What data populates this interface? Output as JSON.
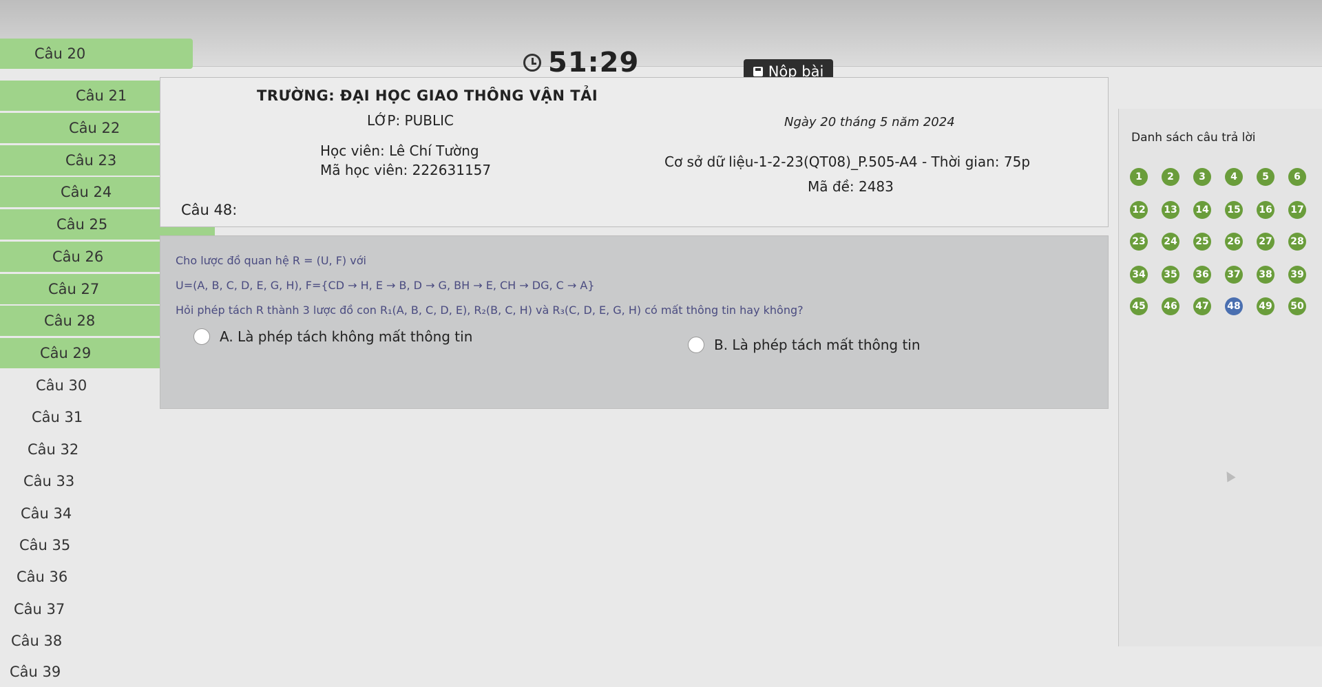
{
  "timer": {
    "value": "51:29"
  },
  "submit": {
    "label": "Nộp bài"
  },
  "nav": {
    "items": [
      {
        "label": "Câu 20",
        "done": true
      },
      {
        "label": "Câu 21",
        "done": true
      },
      {
        "label": "Câu 22",
        "done": true
      },
      {
        "label": "Câu 23",
        "done": true
      },
      {
        "label": "Câu 24",
        "done": true
      },
      {
        "label": "Câu 25",
        "done": true
      },
      {
        "label": "Câu 26",
        "done": true
      },
      {
        "label": "Câu 27",
        "done": true
      },
      {
        "label": "Câu 28",
        "done": true
      },
      {
        "label": "Câu 29",
        "done": true
      },
      {
        "label": "Câu 30",
        "done": false
      },
      {
        "label": "Câu 31",
        "done": false
      },
      {
        "label": "Câu 32",
        "done": false
      },
      {
        "label": "Câu 33",
        "done": false
      },
      {
        "label": "Câu 34",
        "done": false
      },
      {
        "label": "Câu 35",
        "done": false
      },
      {
        "label": "Câu 36",
        "done": false
      },
      {
        "label": "Câu 37",
        "done": false
      },
      {
        "label": "Câu 38",
        "done": false
      },
      {
        "label": "Câu 39",
        "done": false
      }
    ]
  },
  "header": {
    "school": "TRƯỜNG: ĐẠI HỌC GIAO THÔNG VẬN TẢI",
    "class": "LỚP: PUBLIC",
    "date": "Ngày 20 tháng 5 năm 2024",
    "student_name": "Học viên: Lê Chí Tường",
    "student_id": "Mã học viên: 222631157",
    "db_info": "Cơ sở dữ liệu-1-2-23(QT08)_P.505-A4 - Thời gian: 75p",
    "exam_code": "Mã đề: 2483",
    "question_title": "Câu 48:"
  },
  "question": {
    "line1": "Cho lược đồ quan hệ R = (U, F) với",
    "line2": "U=(A, B, C, D, E, G, H), F={CD → H, E → B, D → G, BH → E, CH → DG, C → A}",
    "line3": "Hỏi phép tách R thành 3 lược đồ con R₁(A, B, C, D, E), R₂(B, C, H) và R₃(C, D, E, G, H) có mất thông tin hay không?",
    "option_a": "A. Là phép tách không mất thông tin",
    "option_b": "B. Là phép tách mất thông tin"
  },
  "answers": {
    "title": "Danh sách câu trả lời",
    "rows": [
      [
        "1",
        "2",
        "3",
        "4",
        "5",
        "6"
      ],
      [
        "12",
        "13",
        "14",
        "15",
        "16",
        "17"
      ],
      [
        "23",
        "24",
        "25",
        "26",
        "27",
        "28"
      ],
      [
        "34",
        "35",
        "36",
        "37",
        "38",
        "39"
      ],
      [
        "45",
        "46",
        "47",
        "48",
        "49",
        "50"
      ]
    ],
    "current": "48",
    "colors": {
      "answered": "#6a9d3b",
      "current": "#4a6fb0"
    }
  }
}
